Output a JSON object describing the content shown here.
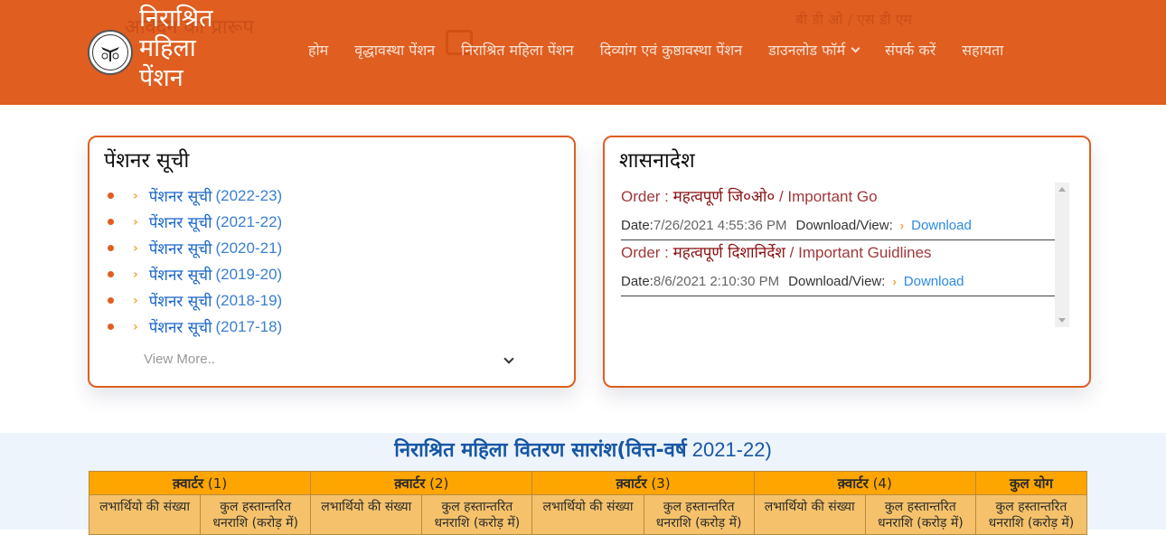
{
  "header": {
    "brand_lines": [
      "निराश्रित",
      "महिला",
      "पेंशन"
    ],
    "ghost_texts": [
      "आवेदन का प्रारूप",
      "बी डी ओ / एस डी एम"
    ],
    "nav": [
      {
        "label": "होम"
      },
      {
        "label": "वृद्धावस्था पेंशन"
      },
      {
        "label": "निराश्रित महिला पेंशन"
      },
      {
        "label": "दिव्यांग एवं कुष्ठावस्था पेंशन"
      },
      {
        "label": "डाउनलोड फॉर्म",
        "has_dropdown": true
      },
      {
        "label": "संपर्क करें"
      },
      {
        "label": "सहायता"
      }
    ],
    "brand_color": "#e05e20"
  },
  "pensioner_list": {
    "title": "पेंशनर सूची",
    "items": [
      {
        "label": "पेंशनर सूची",
        "year": "(2022-23)"
      },
      {
        "label": "पेंशनर सूची",
        "year": "(2021-22)"
      },
      {
        "label": "पेंशनर सूची",
        "year": "(2020-21)"
      },
      {
        "label": "पेंशनर सूची",
        "year": "(2019-20)"
      },
      {
        "label": "पेंशनर सूची",
        "year": "(2018-19)"
      },
      {
        "label": "पेंशनर सूची",
        "year": "(2017-18)"
      }
    ],
    "view_more": "View More.."
  },
  "govt_orders": {
    "title": "शासनादेश",
    "orders": [
      {
        "prefix": "Order : ",
        "title_hi": "महत्वपूर्ण जि०ओ०",
        "title_en": " / Important Go",
        "date_label": "Date:",
        "date": "7/26/2021 4:55:36 PM",
        "download_label": "Download/View:",
        "download_link": "Download"
      },
      {
        "prefix": "Order : ",
        "title_hi": "महत्वपूर्ण दिशानिर्देश",
        "title_en": " / Important Guidlines",
        "date_label": "Date:",
        "date": "8/6/2021 2:10:30 PM",
        "download_label": "Download/View:",
        "download_link": "Download"
      }
    ]
  },
  "summary": {
    "title_hi": "निराश्रित महिला वितरण सारांश(वित्त-वर्ष",
    "title_year": " 2021-22)",
    "quarters": [
      {
        "label": "क़्वार्टर",
        "num": " (1)"
      },
      {
        "label": "क़्वार्टर",
        "num": " (2)"
      },
      {
        "label": "क़्वार्टर",
        "num": " (3)"
      },
      {
        "label": "क़्वार्टर",
        "num": " (4)"
      }
    ],
    "total_label": "कुल योग",
    "col_beneficiaries": "लभार्थियो की संख्या",
    "col_amount": "कुल हस्तान्तरित धनराशि (करोड़ में)"
  }
}
